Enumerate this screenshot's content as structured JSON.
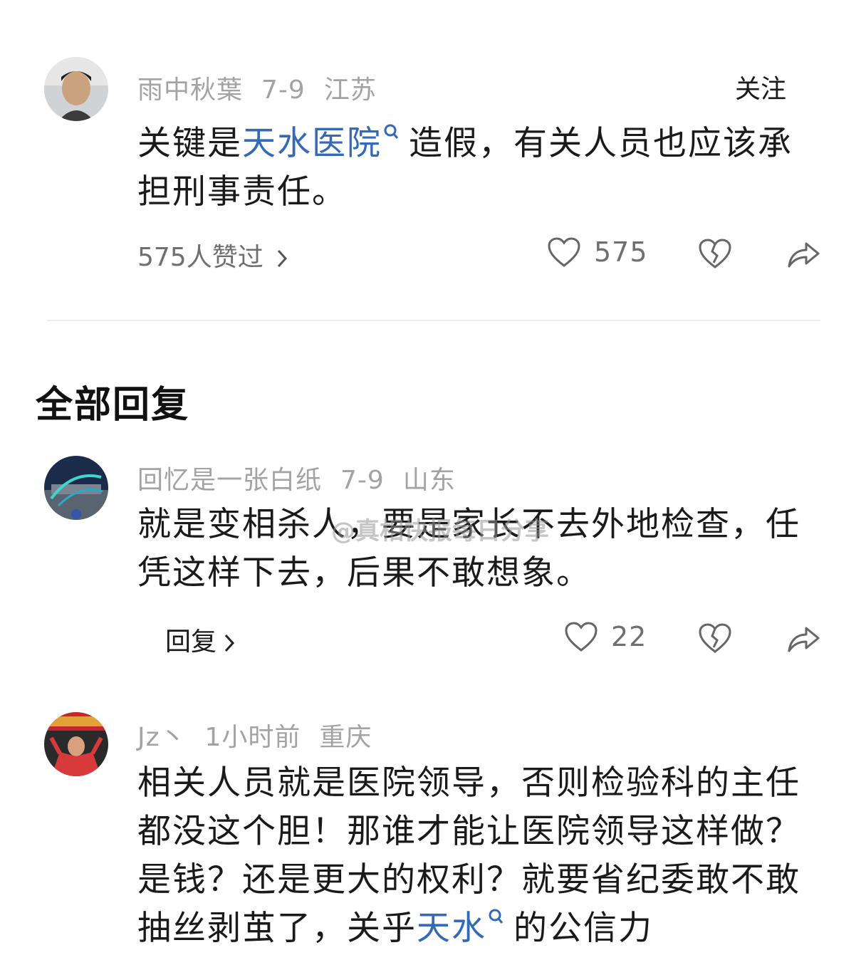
{
  "comment": {
    "username": "雨中秋葉",
    "date": "7-9",
    "location": "江苏",
    "follow_label": "关注",
    "text_before": "关键是",
    "link_text": "天水医院",
    "text_after": "造假，有关人员也应该承担刑事责任。",
    "liked_by_label": "575人赞过",
    "like_count": "575"
  },
  "section": {
    "title": "全部回复"
  },
  "replies": [
    {
      "username": "回忆是一张白纸",
      "date": "7-9",
      "location": "山东",
      "text": "就是变相杀人，要是家长不去外地检查，任凭这样下去，后果不敢想象。",
      "reply_label": "回复",
      "like_count": "22"
    },
    {
      "username": "Jz丶",
      "date": "1小时前",
      "location": "重庆",
      "text_before": "相关人员就是医院领导，否则检验科的主任都没这个胆！那谁才能让医院领导这样做？是钱？还是更大的权利？就要省纪委敢不敢抽丝剥茧了，关乎",
      "link_text": "天水",
      "text_after": "的公信力"
    }
  ],
  "watermark": "@真相快报每日分享",
  "colors": {
    "link": "#3469b8",
    "meta": "#a3a3a3",
    "text": "#1a1a1a"
  },
  "icons": [
    "search-link-icon",
    "heart-icon",
    "broken-heart-icon",
    "share-icon",
    "chevron-right-icon"
  ]
}
